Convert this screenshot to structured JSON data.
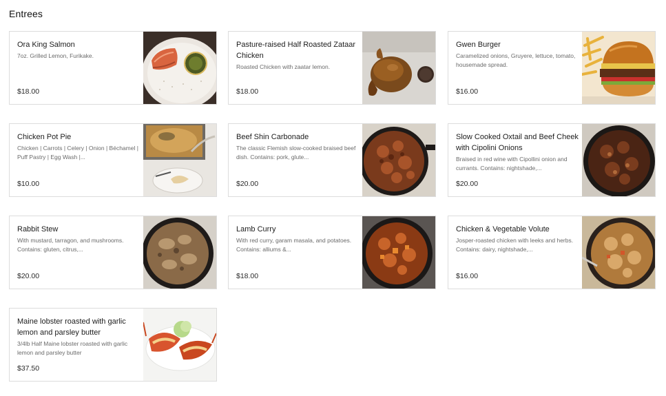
{
  "section": {
    "title": "Entrees"
  },
  "items": [
    {
      "name": "Ora King Salmon",
      "description": "7oz. Grilled Lemon, Furikake.",
      "price": "$18.00",
      "image": "salmon-photo"
    },
    {
      "name": "Pasture-raised Half Roasted Zataar Chicken",
      "description": "Roasted Chicken with zaatar lemon.",
      "price": "$18.00",
      "image": "roast-chicken-photo"
    },
    {
      "name": "Gwen Burger",
      "description": "Caramelized onions, Gruyere, lettuce, tomato, housemade spread.",
      "price": "$16.00",
      "image": "burger-photo"
    },
    {
      "name": "Chicken Pot Pie",
      "description": "Chicken | Carrots | Celery | Onion | Béchamel | Puff Pastry | Egg Wash |...",
      "price": "$10.00",
      "image": "pot-pie-photo"
    },
    {
      "name": "Beef Shin Carbonade",
      "description": "The classic Flemish slow-cooked braised beef dish. Contains: pork, glute...",
      "price": "$20.00",
      "image": "beef-stew-photo"
    },
    {
      "name": "Slow Cooked Oxtail and Beef Cheek with Cipolini Onions",
      "description": "Braised in red wine with Cipollini onion and currants. Contains: nightshade,...",
      "price": "$20.00",
      "image": "oxtail-photo"
    },
    {
      "name": "Rabbit Stew",
      "description": "With mustard, tarragon, and mushrooms. Contains: gluten, citrus,...",
      "price": "$20.00",
      "image": "rabbit-stew-photo"
    },
    {
      "name": "Lamb Curry",
      "description": "With red curry, garam masala, and potatoes. Contains: alliums &...",
      "price": "$18.00",
      "image": "lamb-curry-photo"
    },
    {
      "name": "Chicken & Vegetable Volute",
      "description": "Josper-roasted chicken with leeks and herbs. Contains: dairy, nightshade,...",
      "price": "$16.00",
      "image": "chicken-volute-photo"
    },
    {
      "name": "Maine lobster roasted with garlic lemon and parsley butter",
      "description": "3/4lb Half Maine lobster roasted with garlic lemon and parsley butter",
      "price": "$37.50",
      "image": "lobster-photo"
    }
  ]
}
